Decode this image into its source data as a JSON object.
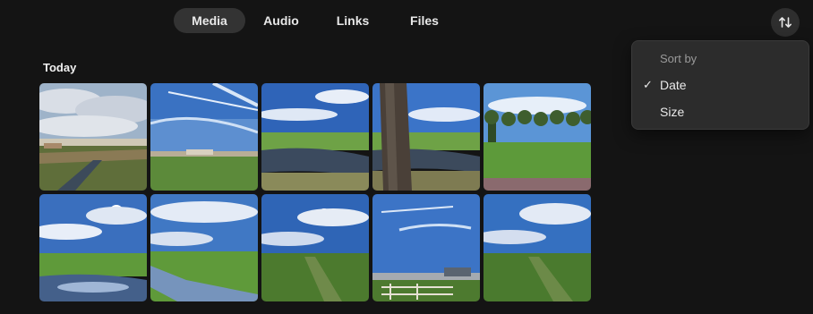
{
  "tabs": [
    {
      "label": "Media",
      "active": true
    },
    {
      "label": "Audio",
      "active": false
    },
    {
      "label": "Links",
      "active": false
    },
    {
      "label": "Files",
      "active": false
    }
  ],
  "sort_button": {
    "icon": "sort-arrows-icon"
  },
  "section": {
    "title": "Today"
  },
  "sort_menu": {
    "header": "Sort by",
    "items": [
      {
        "label": "Date",
        "checked": true,
        "check_glyph": "✓"
      },
      {
        "label": "Size",
        "checked": false
      }
    ]
  },
  "colors": {
    "background": "#141414",
    "active_tab": "#333333",
    "menu_bg": "#2c2c2c"
  }
}
